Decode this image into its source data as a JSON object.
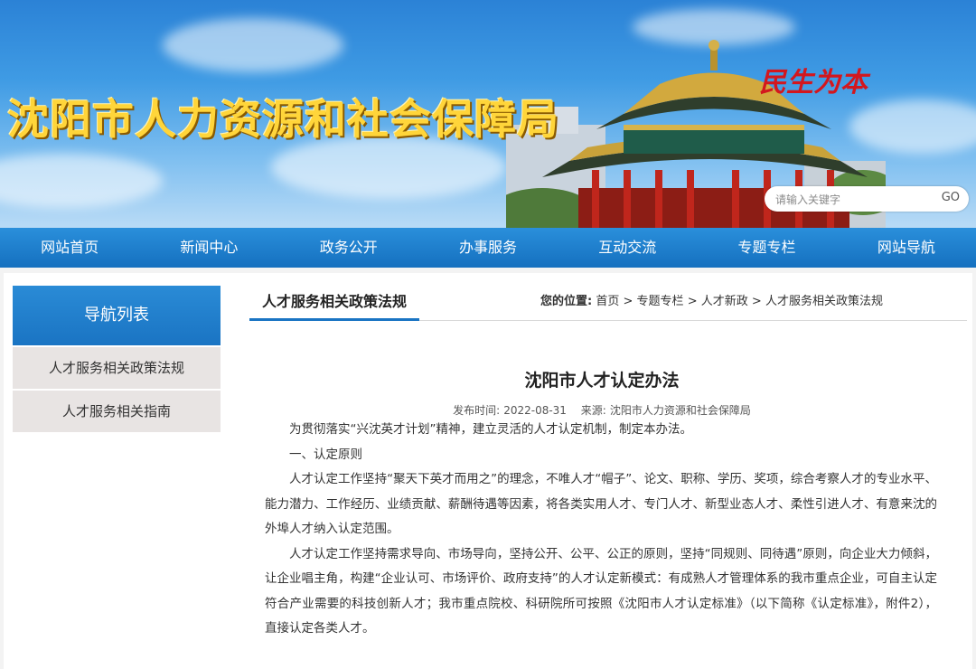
{
  "site": {
    "title": "沈阳市人力资源和社会保障局",
    "slogan": "民生为本"
  },
  "search": {
    "placeholder": "请输入关键字",
    "button": "GO"
  },
  "nav": {
    "items": [
      "网站首页",
      "新闻中心",
      "政务公开",
      "办事服务",
      "互动交流",
      "专题专栏",
      "网站导航"
    ]
  },
  "sidebar": {
    "header": "导航列表",
    "items": [
      "人才服务相关政策法规",
      "人才服务相关指南"
    ]
  },
  "section": {
    "title": "人才服务相关政策法规"
  },
  "breadcrumb": {
    "label": "您的位置:",
    "items": [
      "首页",
      "专题专栏",
      "人才新政",
      "人才服务相关政策法规"
    ],
    "separator": ">"
  },
  "article": {
    "title": "沈阳市人才认定办法",
    "publish_label": "发布时间:",
    "publish_date": "2022-08-31",
    "source_label": "来源:",
    "source": "沈阳市人力资源和社会保障局",
    "paragraphs": [
      "为贯彻落实“兴沈英才计划”精神，建立灵活的人才认定机制，制定本办法。",
      "一、认定原则",
      "人才认定工作坚持“聚天下英才而用之”的理念，不唯人才“帽子”、论文、职称、学历、奖项，综合考察人才的专业水平、能力潜力、工作经历、业绩贡献、薪酬待遇等因素，将各类实用人才、专门人才、新型业态人才、柔性引进人才、有意来沈的外埠人才纳入认定范围。",
      "人才认定工作坚持需求导向、市场导向，坚持公开、公平、公正的原则，坚持“同规则、同待遇”原则，向企业大力倾斜，让企业唱主角，构建“企业认可、市场评价、政府支持”的人才认定新模式：有成熟人才管理体系的我市重点企业，可自主认定符合产业需要的科技创新人才；我市重点院校、科研院所可按照《沈阳市人才认定标准》（以下简称《认定标准》，附件2），直接认定各类人才。"
    ]
  },
  "colors": {
    "nav_blue": "#1a74c3",
    "title_gold": "#ffd53a",
    "slogan_red": "#d3171e",
    "sidebar_item_bg": "#e8e4e3"
  }
}
